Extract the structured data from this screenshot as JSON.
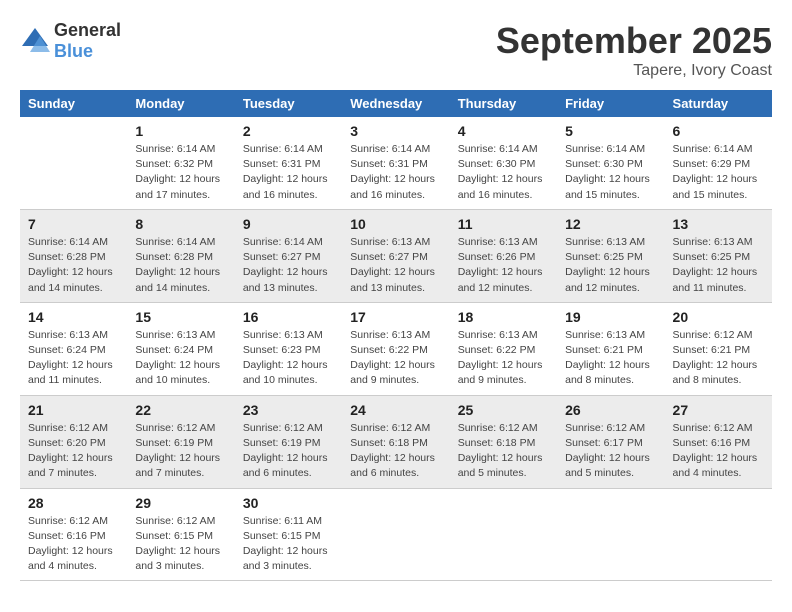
{
  "logo": {
    "text_general": "General",
    "text_blue": "Blue"
  },
  "title": "September 2025",
  "location": "Tapere, Ivory Coast",
  "days_of_week": [
    "Sunday",
    "Monday",
    "Tuesday",
    "Wednesday",
    "Thursday",
    "Friday",
    "Saturday"
  ],
  "weeks": [
    [
      {
        "day": "",
        "info": ""
      },
      {
        "day": "1",
        "info": "Sunrise: 6:14 AM\nSunset: 6:32 PM\nDaylight: 12 hours\nand 17 minutes."
      },
      {
        "day": "2",
        "info": "Sunrise: 6:14 AM\nSunset: 6:31 PM\nDaylight: 12 hours\nand 16 minutes."
      },
      {
        "day": "3",
        "info": "Sunrise: 6:14 AM\nSunset: 6:31 PM\nDaylight: 12 hours\nand 16 minutes."
      },
      {
        "day": "4",
        "info": "Sunrise: 6:14 AM\nSunset: 6:30 PM\nDaylight: 12 hours\nand 16 minutes."
      },
      {
        "day": "5",
        "info": "Sunrise: 6:14 AM\nSunset: 6:30 PM\nDaylight: 12 hours\nand 15 minutes."
      },
      {
        "day": "6",
        "info": "Sunrise: 6:14 AM\nSunset: 6:29 PM\nDaylight: 12 hours\nand 15 minutes."
      }
    ],
    [
      {
        "day": "7",
        "info": "Sunrise: 6:14 AM\nSunset: 6:28 PM\nDaylight: 12 hours\nand 14 minutes."
      },
      {
        "day": "8",
        "info": "Sunrise: 6:14 AM\nSunset: 6:28 PM\nDaylight: 12 hours\nand 14 minutes."
      },
      {
        "day": "9",
        "info": "Sunrise: 6:14 AM\nSunset: 6:27 PM\nDaylight: 12 hours\nand 13 minutes."
      },
      {
        "day": "10",
        "info": "Sunrise: 6:13 AM\nSunset: 6:27 PM\nDaylight: 12 hours\nand 13 minutes."
      },
      {
        "day": "11",
        "info": "Sunrise: 6:13 AM\nSunset: 6:26 PM\nDaylight: 12 hours\nand 12 minutes."
      },
      {
        "day": "12",
        "info": "Sunrise: 6:13 AM\nSunset: 6:25 PM\nDaylight: 12 hours\nand 12 minutes."
      },
      {
        "day": "13",
        "info": "Sunrise: 6:13 AM\nSunset: 6:25 PM\nDaylight: 12 hours\nand 11 minutes."
      }
    ],
    [
      {
        "day": "14",
        "info": "Sunrise: 6:13 AM\nSunset: 6:24 PM\nDaylight: 12 hours\nand 11 minutes."
      },
      {
        "day": "15",
        "info": "Sunrise: 6:13 AM\nSunset: 6:24 PM\nDaylight: 12 hours\nand 10 minutes."
      },
      {
        "day": "16",
        "info": "Sunrise: 6:13 AM\nSunset: 6:23 PM\nDaylight: 12 hours\nand 10 minutes."
      },
      {
        "day": "17",
        "info": "Sunrise: 6:13 AM\nSunset: 6:22 PM\nDaylight: 12 hours\nand 9 minutes."
      },
      {
        "day": "18",
        "info": "Sunrise: 6:13 AM\nSunset: 6:22 PM\nDaylight: 12 hours\nand 9 minutes."
      },
      {
        "day": "19",
        "info": "Sunrise: 6:13 AM\nSunset: 6:21 PM\nDaylight: 12 hours\nand 8 minutes."
      },
      {
        "day": "20",
        "info": "Sunrise: 6:12 AM\nSunset: 6:21 PM\nDaylight: 12 hours\nand 8 minutes."
      }
    ],
    [
      {
        "day": "21",
        "info": "Sunrise: 6:12 AM\nSunset: 6:20 PM\nDaylight: 12 hours\nand 7 minutes."
      },
      {
        "day": "22",
        "info": "Sunrise: 6:12 AM\nSunset: 6:19 PM\nDaylight: 12 hours\nand 7 minutes."
      },
      {
        "day": "23",
        "info": "Sunrise: 6:12 AM\nSunset: 6:19 PM\nDaylight: 12 hours\nand 6 minutes."
      },
      {
        "day": "24",
        "info": "Sunrise: 6:12 AM\nSunset: 6:18 PM\nDaylight: 12 hours\nand 6 minutes."
      },
      {
        "day": "25",
        "info": "Sunrise: 6:12 AM\nSunset: 6:18 PM\nDaylight: 12 hours\nand 5 minutes."
      },
      {
        "day": "26",
        "info": "Sunrise: 6:12 AM\nSunset: 6:17 PM\nDaylight: 12 hours\nand 5 minutes."
      },
      {
        "day": "27",
        "info": "Sunrise: 6:12 AM\nSunset: 6:16 PM\nDaylight: 12 hours\nand 4 minutes."
      }
    ],
    [
      {
        "day": "28",
        "info": "Sunrise: 6:12 AM\nSunset: 6:16 PM\nDaylight: 12 hours\nand 4 minutes."
      },
      {
        "day": "29",
        "info": "Sunrise: 6:12 AM\nSunset: 6:15 PM\nDaylight: 12 hours\nand 3 minutes."
      },
      {
        "day": "30",
        "info": "Sunrise: 6:11 AM\nSunset: 6:15 PM\nDaylight: 12 hours\nand 3 minutes."
      },
      {
        "day": "",
        "info": ""
      },
      {
        "day": "",
        "info": ""
      },
      {
        "day": "",
        "info": ""
      },
      {
        "day": "",
        "info": ""
      }
    ]
  ]
}
